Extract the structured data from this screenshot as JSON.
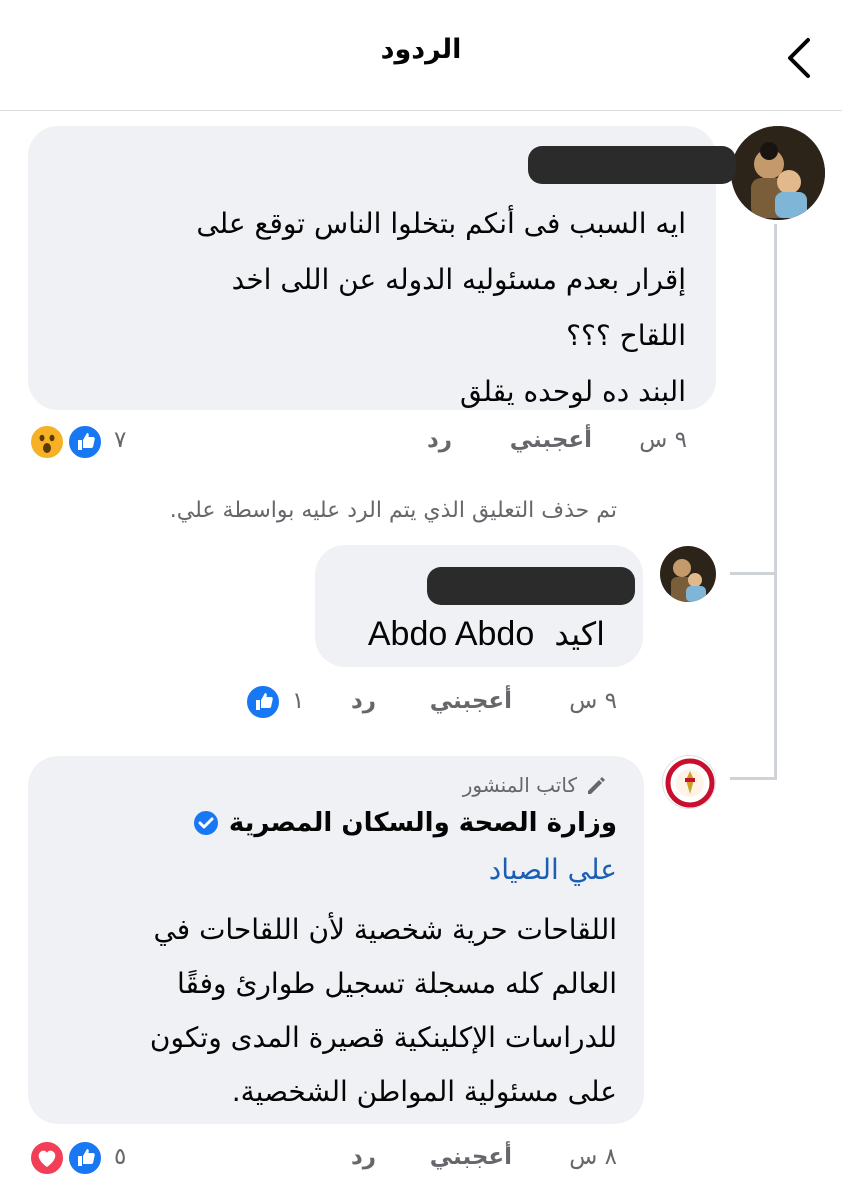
{
  "header": {
    "title": "الردود",
    "back_icon": "chevron-left-icon"
  },
  "comment1": {
    "author_redacted": true,
    "lines": [
      "ايه السبب فى أنكم بتخلوا الناس توقع على",
      "إقرار بعدم مسئوليه الدوله عن اللى اخد",
      "اللقاح ؟؟؟",
      "البند ده لوحده يقلق"
    ],
    "time": "٩ س",
    "like_label": "أعجبني",
    "reply_label": "رد",
    "reaction_count": "٧",
    "reactions": [
      "like-icon",
      "wow-icon"
    ]
  },
  "deleted_notice": "تم حذف التعليق الذي يتم الرد عليه بواسطة علي.",
  "comment2": {
    "author_redacted": true,
    "text_word": "اكيد",
    "mention": "Abdo Abdo",
    "time": "٩ س",
    "like_label": "أعجبني",
    "reply_label": "رد",
    "reaction_count": "١",
    "reactions": [
      "like-icon"
    ]
  },
  "comment3": {
    "badge_label": "كاتب المنشور",
    "page_name": "وزارة الصحة والسكان المصرية",
    "mention": "علي الصياد",
    "lines": [
      "اللقاحات حرية شخصية لأن اللقاحات في",
      "العالم كله مسجلة تسجيل طوارئ وفقًا",
      "للدراسات الإكلينكية قصيرة المدى وتكون",
      "على مسئولية المواطن الشخصية."
    ],
    "time": "٨ س",
    "like_label": "أعجبني",
    "reply_label": "رد",
    "reaction_count": "٥",
    "reactions": [
      "like-icon",
      "love-icon"
    ]
  },
  "colors": {
    "bubble": "#eff1f4",
    "link": "#1b5fb5",
    "like": "#1877f2",
    "love": "#f33e58",
    "wow": "#f7b125",
    "meta": "#65676b"
  }
}
